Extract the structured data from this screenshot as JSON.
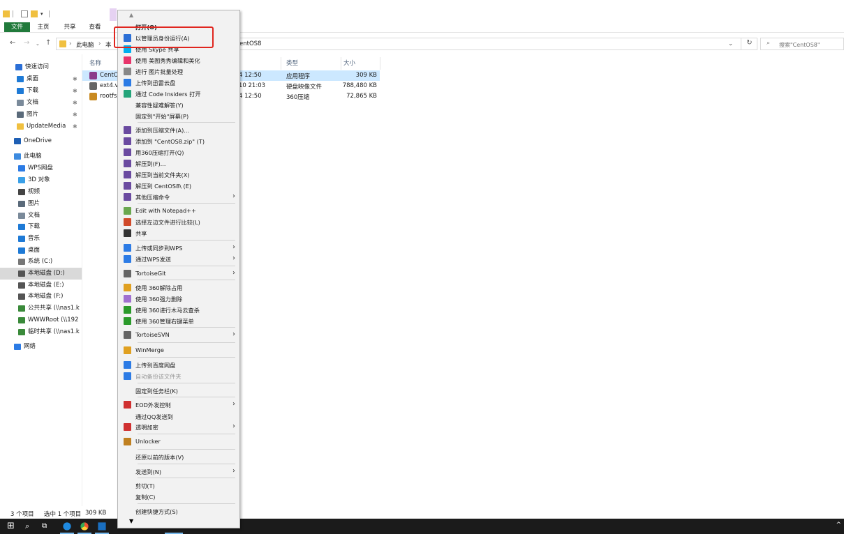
{
  "ribbon": {
    "tabs": [
      "文件",
      "主页",
      "共享",
      "查看"
    ]
  },
  "address": {
    "crumbs": [
      "此电脑",
      "本",
      "entOS8"
    ],
    "search_placeholder": "搜索\"CentOS8\""
  },
  "sidebar": {
    "items": [
      {
        "label": "快速访问",
        "icon": "star-icon",
        "color": "#2b6fd6"
      },
      {
        "label": "桌面",
        "icon": "desktop-icon",
        "color": "#1e7ad6",
        "pinned": true
      },
      {
        "label": "下载",
        "icon": "download-icon",
        "color": "#1e7ad6",
        "pinned": true
      },
      {
        "label": "文档",
        "icon": "document-icon",
        "color": "#7a8a9a",
        "pinned": true
      },
      {
        "label": "图片",
        "icon": "picture-icon",
        "color": "#5a6a7a",
        "pinned": true
      },
      {
        "label": "UpdateMedia",
        "icon": "folder-icon",
        "color": "#f0c040",
        "pinned": true
      },
      {
        "label": "OneDrive",
        "icon": "cloud-icon",
        "color": "#1e5fb4"
      },
      {
        "label": "此电脑",
        "icon": "computer-icon",
        "color": "#3d8be0"
      },
      {
        "label": "WPS网盘",
        "icon": "cloud-drive-icon",
        "color": "#2c7be5"
      },
      {
        "label": "3D 对象",
        "icon": "cube-icon",
        "color": "#3aa0e8"
      },
      {
        "label": "视频",
        "icon": "video-icon",
        "color": "#444"
      },
      {
        "label": "图片",
        "icon": "picture-icon",
        "color": "#5a6a7a"
      },
      {
        "label": "文档",
        "icon": "document-icon",
        "color": "#7a8a9a"
      },
      {
        "label": "下载",
        "icon": "download-icon",
        "color": "#1e7ad6"
      },
      {
        "label": "音乐",
        "icon": "music-icon",
        "color": "#1e7ad6"
      },
      {
        "label": "桌面",
        "icon": "desktop-icon",
        "color": "#1e7ad6"
      },
      {
        "label": "系统 (C:)",
        "icon": "drive-icon",
        "color": "#777"
      },
      {
        "label": "本地磁盘 (D:)",
        "icon": "drive-icon",
        "color": "#555",
        "selected": true
      },
      {
        "label": "本地磁盘 (E:)",
        "icon": "drive-icon",
        "color": "#555"
      },
      {
        "label": "本地磁盘 (F:)",
        "icon": "drive-icon",
        "color": "#555"
      },
      {
        "label": "公共共享 (\\\\nas1.k",
        "icon": "network-drive-icon",
        "color": "#3a8a3a"
      },
      {
        "label": "WWWRoot (\\\\192",
        "icon": "network-drive-icon",
        "color": "#3a8a3a"
      },
      {
        "label": "临时共享 (\\\\nas1.k",
        "icon": "network-drive-icon",
        "color": "#3a8a3a"
      },
      {
        "label": "网络",
        "icon": "network-icon",
        "color": "#2c7be5"
      }
    ]
  },
  "columns": {
    "name": "名称",
    "type": "类型",
    "size": "大小"
  },
  "files": [
    {
      "name": "CentO",
      "date": "4 12:50",
      "type": "应用程序",
      "size": "309 KB",
      "icon_color": "#8a3a8a",
      "selected": true
    },
    {
      "name": "ext4.vl",
      "date": "10 21:03",
      "type": "硬盘映像文件",
      "size": "788,480 KB",
      "icon_color": "#666"
    },
    {
      "name": "rootfs",
      "date": "4 12:50",
      "type": "360压缩",
      "size": "72,865 KB",
      "icon_color": "#c98a20"
    }
  ],
  "status": {
    "count": "3 个项目",
    "selection": "选中 1 个项目",
    "size": "309 KB"
  },
  "context_menu": {
    "open": "打开(O)",
    "items": [
      {
        "label": "以管理员身份运行(A)",
        "icon": "uac-shield-icon",
        "color": "#2b6fd6"
      },
      {
        "label": "使用 Skype 共享",
        "icon": "skype-icon",
        "color": "#00aff0"
      },
      {
        "label": "使用 美图秀秀编辑和美化",
        "icon": "meitu-icon",
        "color": "#e8356b"
      },
      {
        "label": "进行 图片批量处理",
        "icon": "batch-image-icon",
        "color": "#888"
      },
      {
        "label": "上传到迅雷云盘",
        "icon": "xunlei-icon",
        "color": "#2c7be5"
      },
      {
        "label": "通过 Code Insiders 打开",
        "icon": "vscode-icon",
        "color": "#24a47a"
      },
      {
        "label": "兼容性疑难解答(Y)",
        "icon": "",
        "color": ""
      },
      {
        "label": "固定到\"开始\"屏幕(P)",
        "icon": "",
        "color": ""
      },
      {
        "label": "添加到压缩文件(A)...",
        "icon": "winrar-icon",
        "color": "#6a4aa0"
      },
      {
        "label": "添加到 \"CentOS8.zip\" (T)",
        "icon": "winrar-icon",
        "color": "#6a4aa0"
      },
      {
        "label": "用360压缩打开(Q)",
        "icon": "winrar-icon",
        "color": "#6a4aa0"
      },
      {
        "label": "解压到(F)...",
        "icon": "winrar-icon",
        "color": "#6a4aa0"
      },
      {
        "label": "解压到当前文件夹(X)",
        "icon": "winrar-icon",
        "color": "#6a4aa0"
      },
      {
        "label": "解压到 CentOS8\\ (E)",
        "icon": "winrar-icon",
        "color": "#6a4aa0"
      },
      {
        "label": "其他压缩命令",
        "icon": "winrar-icon",
        "color": "#6a4aa0",
        "submenu": true
      },
      {
        "label": "Edit with Notepad++",
        "icon": "notepad-plus-icon",
        "color": "#6aa84f"
      },
      {
        "label": "选择左边文件进行比较(L)",
        "icon": "compare-icon",
        "color": "#d04a2a"
      },
      {
        "label": "共享",
        "icon": "share-icon",
        "color": "#333"
      },
      {
        "label": "上传或同步到WPS",
        "icon": "wps-cloud-icon",
        "color": "#2c7be5",
        "submenu": true
      },
      {
        "label": "通过WPS发送",
        "icon": "wps-send-icon",
        "color": "#2c7be5",
        "submenu": true
      },
      {
        "label": "TortoiseGit",
        "icon": "tortoisegit-icon",
        "color": "#666",
        "submenu": true
      },
      {
        "label": "使用 360解除占用",
        "icon": "unlock-360-icon",
        "color": "#e0a020"
      },
      {
        "label": "使用 360强力删除",
        "icon": "delete-360-icon",
        "color": "#a070d0"
      },
      {
        "label": "使用 360进行木马云查杀",
        "icon": "scan-360-icon",
        "color": "#2a9a2a"
      },
      {
        "label": "使用 360管理右键菜单",
        "icon": "menu-360-icon",
        "color": "#2a9a2a"
      },
      {
        "label": "TortoiseSVN",
        "icon": "tortoisesvn-icon",
        "color": "#666",
        "submenu": true
      },
      {
        "label": "WinMerge",
        "icon": "winmerge-icon",
        "color": "#e0a020"
      },
      {
        "label": "上传到百度网盘",
        "icon": "baidu-cloud-icon",
        "color": "#2c7be5"
      },
      {
        "label": "自动备份该文件夹",
        "icon": "baidu-cloud-icon",
        "color": "#2c7be5",
        "disabled": true
      },
      {
        "label": "固定到任务栏(K)",
        "icon": "",
        "color": ""
      },
      {
        "label": "EOD外发控制",
        "icon": "eod-icon",
        "color": "#d03030",
        "submenu": true
      },
      {
        "label": "通过QQ发送到",
        "icon": "",
        "color": ""
      },
      {
        "label": "透明加密",
        "icon": "encrypt-icon",
        "color": "#d03030",
        "submenu": true
      },
      {
        "label": "Unlocker",
        "icon": "unlocker-icon",
        "color": "#c08020"
      },
      {
        "label": "还原以前的版本(V)",
        "icon": "",
        "color": ""
      },
      {
        "label": "发送到(N)",
        "icon": "",
        "color": "",
        "submenu": true
      },
      {
        "label": "剪切(T)",
        "icon": "",
        "color": ""
      },
      {
        "label": "复制(C)",
        "icon": "",
        "color": ""
      },
      {
        "label": "创建快捷方式(S)",
        "icon": "",
        "color": ""
      }
    ]
  },
  "colors": {
    "file_tab": "#217a3b",
    "highlight_box": "#e0261f",
    "selection": "#cce8ff",
    "taskbar": "#1b1b1b"
  }
}
